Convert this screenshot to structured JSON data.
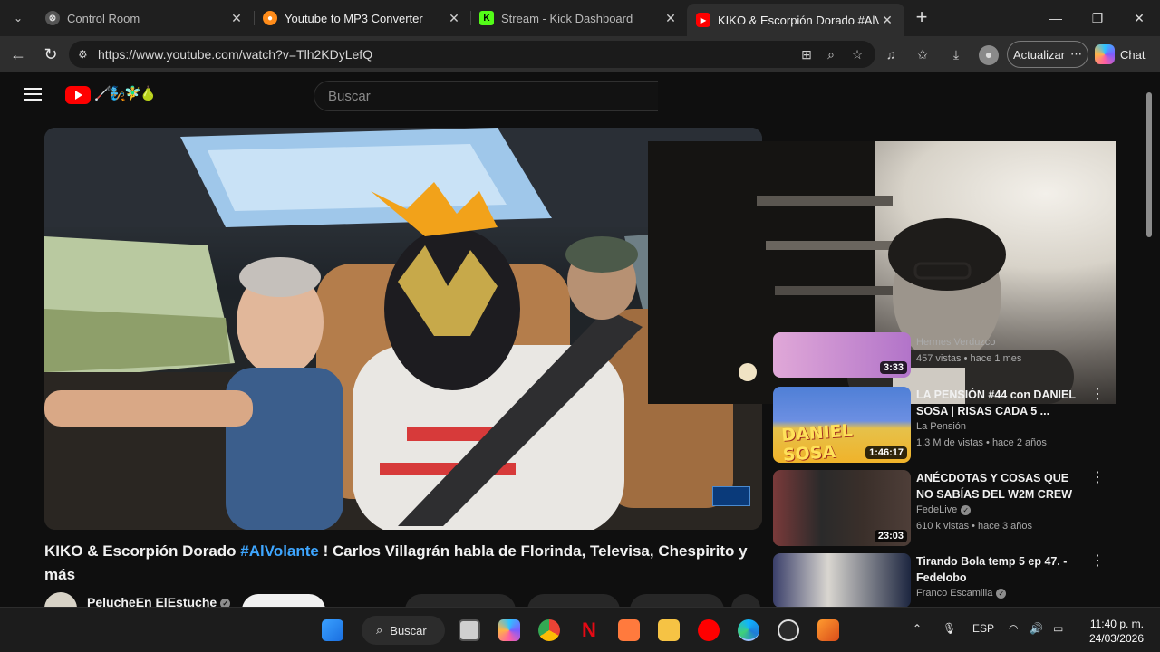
{
  "browser": {
    "tabs": [
      {
        "title": "Control Room",
        "icon": "control-room-icon",
        "active": false
      },
      {
        "title": "Youtube to MP3 Converter",
        "icon": "converter-icon",
        "active": false
      },
      {
        "title": "Stream - Kick Dashboard",
        "icon": "kick-icon",
        "active": false
      },
      {
        "title": "KIKO & Escorpión Dorado #AlVola",
        "icon": "youtube-icon",
        "active": true
      }
    ],
    "url": "https://www.youtube.com/watch?v=Tlh2KDyLefQ",
    "update_label": "Actualizar",
    "chat_label": "Chat"
  },
  "youtube": {
    "search_placeholder": "Buscar",
    "doodle": "🦯🧞🧚‍♂️🍐",
    "video": {
      "title_part1": "KIKO & Escorpión Dorado ",
      "title_hashtag": "#AlVolante",
      "title_part2": " ! Carlos Villagrán habla de Florinda, Televisa, Chespirito y más",
      "channel": "PelucheEn ElEstuche"
    },
    "recommendations": [
      {
        "title": "",
        "channel": "Hermes Verduzco",
        "meta": "457 vistas • hace 1 mes",
        "duration": "3:33",
        "verified": false
      },
      {
        "title": "LA PENSIÓN #44 con DANIEL SOSA | RISAS CADA 5 ...",
        "channel": "La Pensión",
        "meta": "1.3 M de vistas • hace 2 años",
        "duration": "1:46:17",
        "verified": false
      },
      {
        "title": "ANÉCDOTAS Y COSAS QUE NO SABÍAS DEL W2M CREW",
        "channel": "FedeLive",
        "meta": "610 k vistas • hace 3 años",
        "duration": "23:03",
        "verified": true
      },
      {
        "title": "Tirando Bola temp 5 ep 47. - Fedelobo",
        "channel": "Franco Escamilla",
        "meta": "",
        "duration": "",
        "verified": true
      }
    ],
    "thumb_text": {
      "daniel_sosa": "DANIEL SOSA"
    }
  },
  "taskbar": {
    "search_label": "Buscar",
    "language": "ESP",
    "time": "11:40 p. m.",
    "date": "24/03/2026"
  },
  "colors": {
    "accent_link": "#3ea6ff",
    "yt_red": "#ff0000"
  }
}
